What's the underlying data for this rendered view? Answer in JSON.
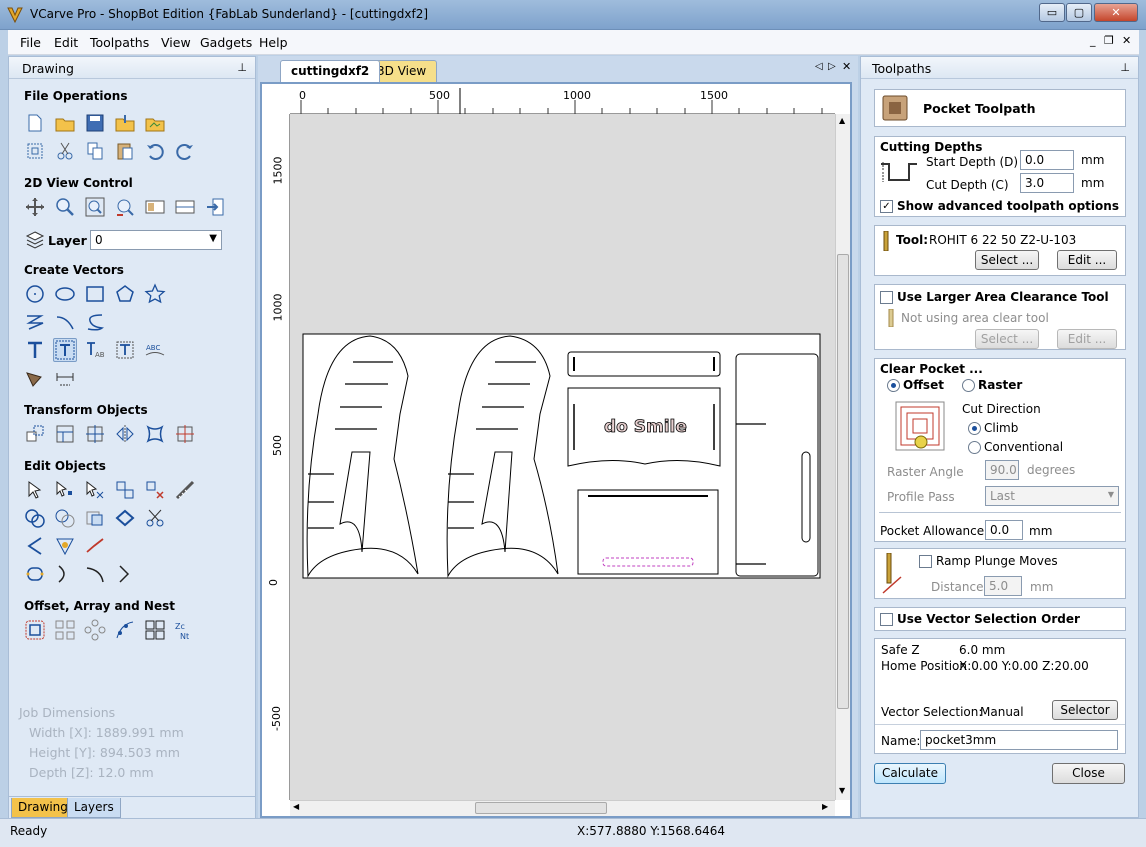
{
  "window": {
    "title": "VCarve Pro - ShopBot Edition {FabLab Sunderland} - [cuttingdxf2]",
    "minimize": "▭",
    "maximize": "▢",
    "close": "✕"
  },
  "menubar": {
    "items": [
      "File",
      "Edit",
      "Toolpaths",
      "View",
      "Gadgets",
      "Help"
    ],
    "mdi_min": "_",
    "mdi_restore": "❐",
    "mdi_close": "✕"
  },
  "drawing_panel": {
    "title": "Drawing",
    "pin": "⊥",
    "sections": {
      "file_operations": "File Operations",
      "view_control": "2D View Control",
      "layer_label": "Layer",
      "layer_value": "0",
      "create_vectors": "Create Vectors",
      "transform_objects": "Transform Objects",
      "edit_objects": "Edit Objects",
      "offset_array": "Offset, Array and Nest"
    },
    "job_dimensions": {
      "title": "Job Dimensions",
      "width": "Width  [X]: 1889.991 mm",
      "height": "Height [Y]: 894.503 mm",
      "depth": "Depth  [Z]: 12.0 mm"
    },
    "tabs": [
      "Drawing",
      "Layers"
    ]
  },
  "document": {
    "tabs": [
      "cuttingdxf2",
      "3D View"
    ],
    "h_ruler": [
      "0",
      "500",
      "1000",
      "1500"
    ],
    "v_ruler": [
      "1500",
      "1000",
      "500",
      "0",
      "-500"
    ],
    "design_text": "do Smile"
  },
  "toolpaths_panel": {
    "title": "Toolpaths",
    "pin": "⊥",
    "header": "Pocket Toolpath",
    "cutting_depths": {
      "title": "Cutting Depths",
      "start_label": "Start Depth (D)",
      "start_value": "0.0",
      "cut_label": "Cut Depth (C)",
      "cut_value": "3.0",
      "unit": "mm",
      "advanced_label": "Show advanced toolpath options",
      "advanced_checked": "✓"
    },
    "tool": {
      "label": "Tool:",
      "name": "ROHIT 6 22 50   Z2-U-103",
      "select": "Select ...",
      "edit": "Edit ..."
    },
    "clearance": {
      "label": "Use Larger Area Clearance Tool",
      "note": "Not using area clear tool",
      "select": "Select ...",
      "edit": "Edit ..."
    },
    "clear_pocket": {
      "title": "Clear Pocket ...",
      "offset": "Offset",
      "raster": "Raster",
      "cut_direction": "Cut Direction",
      "climb": "Climb",
      "conventional": "Conventional",
      "raster_angle_label": "Raster Angle",
      "raster_angle_value": "90.0",
      "raster_angle_unit": "degrees",
      "profile_pass_label": "Profile Pass",
      "profile_pass_value": "Last"
    },
    "allowance": {
      "label": "Pocket Allowance",
      "value": "0.0",
      "unit": "mm"
    },
    "ramp": {
      "label": "Ramp Plunge Moves",
      "distance_label": "Distance",
      "distance_value": "5.0",
      "unit": "mm"
    },
    "vector_order": {
      "label": "Use Vector Selection Order"
    },
    "summary": {
      "safe_z_label": "Safe Z",
      "safe_z_value": "6.0 mm",
      "home_label": "Home Position",
      "home_value": "X:0.00 Y:0.00 Z:20.00",
      "vector_sel_label": "Vector Selection:",
      "vector_sel_value": "Manual",
      "selector": "Selector ...",
      "name_label": "Name:",
      "name_value": "pocket3mm"
    },
    "calculate": "Calculate",
    "close": "Close"
  },
  "statusbar": {
    "ready": "Ready",
    "coords": "X:577.8880 Y:1568.6464"
  },
  "colors": {
    "accent": "#1b4f9c",
    "panel_bg": "#dfe9f5",
    "canvas_bg": "#dcdcdc"
  }
}
